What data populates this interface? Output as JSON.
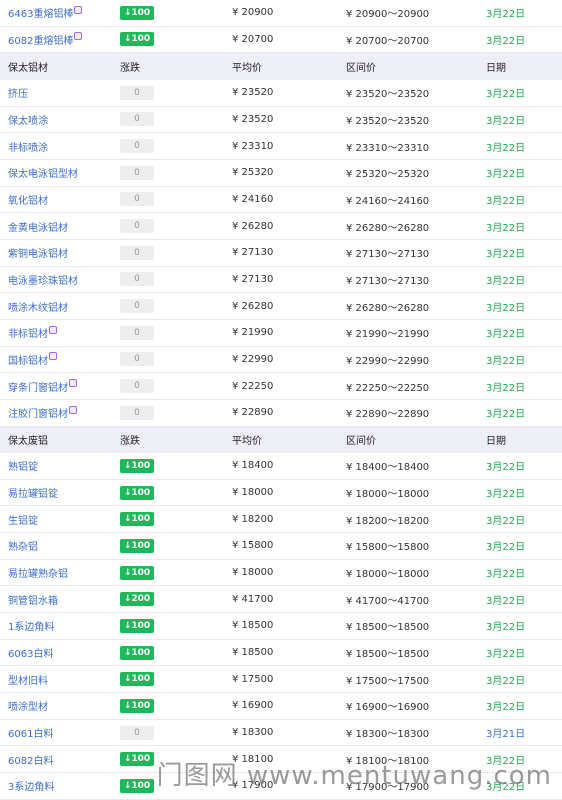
{
  "header": {
    "name": "",
    "change": "涨跌",
    "avg": "平均价",
    "range": "区间价",
    "date": "日期"
  },
  "rows": [
    {
      "type": "item",
      "name": "6463重熔铝棒",
      "mark": true,
      "change": "↓100",
      "dir": "up",
      "avg": "¥  20900",
      "range": "¥  20900～20900",
      "date": "3月22日"
    },
    {
      "type": "item",
      "name": "6082重熔铝棒",
      "mark": true,
      "change": "↓100",
      "dir": "up",
      "avg": "¥  20700",
      "range": "¥  20700～20700",
      "date": "3月22日"
    },
    {
      "type": "header",
      "name": "保太铝材"
    },
    {
      "type": "item",
      "name": "挤压",
      "mark": false,
      "change": "0",
      "dir": "flat",
      "avg": "¥  23520",
      "range": "¥  23520～23520",
      "date": "3月22日"
    },
    {
      "type": "item",
      "name": "保太喷涂",
      "mark": false,
      "change": "0",
      "dir": "flat",
      "avg": "¥  23520",
      "range": "¥  23520～23520",
      "date": "3月22日"
    },
    {
      "type": "item",
      "name": "非标喷涂",
      "mark": false,
      "change": "0",
      "dir": "flat",
      "avg": "¥  23310",
      "range": "¥  23310～23310",
      "date": "3月22日"
    },
    {
      "type": "item",
      "name": "保太电泳铝型材",
      "mark": false,
      "change": "0",
      "dir": "flat",
      "avg": "¥  25320",
      "range": "¥  25320～25320",
      "date": "3月22日"
    },
    {
      "type": "item",
      "name": "氧化铝材",
      "mark": false,
      "change": "0",
      "dir": "flat",
      "avg": "¥  24160",
      "range": "¥  24160～24160",
      "date": "3月22日"
    },
    {
      "type": "item",
      "name": "金黄电泳铝材",
      "mark": false,
      "change": "0",
      "dir": "flat",
      "avg": "¥  26280",
      "range": "¥  26280～26280",
      "date": "3月22日"
    },
    {
      "type": "item",
      "name": "紫铜电泳铝材",
      "mark": false,
      "change": "0",
      "dir": "flat",
      "avg": "¥  27130",
      "range": "¥  27130～27130",
      "date": "3月22日"
    },
    {
      "type": "item",
      "name": "电泳墨珍珠铝材",
      "mark": false,
      "change": "0",
      "dir": "flat",
      "avg": "¥  27130",
      "range": "¥  27130～27130",
      "date": "3月22日"
    },
    {
      "type": "item",
      "name": "喷涂木纹铝材",
      "mark": false,
      "change": "0",
      "dir": "flat",
      "avg": "¥  26280",
      "range": "¥  26280～26280",
      "date": "3月22日"
    },
    {
      "type": "item",
      "name": "非标铝材",
      "mark": true,
      "change": "0",
      "dir": "flat",
      "avg": "¥  21990",
      "range": "¥  21990～21990",
      "date": "3月22日"
    },
    {
      "type": "item",
      "name": "国标铝材",
      "mark": true,
      "change": "0",
      "dir": "flat",
      "avg": "¥  22990",
      "range": "¥  22990～22990",
      "date": "3月22日"
    },
    {
      "type": "item",
      "name": "穿条门窗铝材",
      "mark": true,
      "change": "0",
      "dir": "flat",
      "avg": "¥  22250",
      "range": "¥  22250～22250",
      "date": "3月22日"
    },
    {
      "type": "item",
      "name": "注胶门窗铝材",
      "mark": true,
      "change": "0",
      "dir": "flat",
      "avg": "¥  22890",
      "range": "¥  22890～22890",
      "date": "3月22日"
    },
    {
      "type": "header",
      "name": "保太废铝"
    },
    {
      "type": "item",
      "name": "熟铝锭",
      "mark": false,
      "change": "↓100",
      "dir": "up",
      "avg": "¥  18400",
      "range": "¥  18400～18400",
      "date": "3月22日"
    },
    {
      "type": "item",
      "name": "易拉罐铝锭",
      "mark": false,
      "change": "↓100",
      "dir": "up",
      "avg": "¥  18000",
      "range": "¥  18000～18000",
      "date": "3月22日"
    },
    {
      "type": "item",
      "name": "生铝锭",
      "mark": false,
      "change": "↓100",
      "dir": "up",
      "avg": "¥  18200",
      "range": "¥  18200～18200",
      "date": "3月22日"
    },
    {
      "type": "item",
      "name": "熟杂铝",
      "mark": false,
      "change": "↓100",
      "dir": "up",
      "avg": "¥  15800",
      "range": "¥  15800～15800",
      "date": "3月22日"
    },
    {
      "type": "item",
      "name": "易拉罐熟杂铝",
      "mark": false,
      "change": "↓100",
      "dir": "up",
      "avg": "¥  18000",
      "range": "¥  18000～18000",
      "date": "3月22日"
    },
    {
      "type": "item",
      "name": "铜管铝水箱",
      "mark": false,
      "change": "↓200",
      "dir": "up",
      "avg": "¥  41700",
      "range": "¥  41700～41700",
      "date": "3月22日"
    },
    {
      "type": "item",
      "name": "1系边角料",
      "mark": false,
      "change": "↓100",
      "dir": "up",
      "avg": "¥  18500",
      "range": "¥  18500～18500",
      "date": "3月22日"
    },
    {
      "type": "item",
      "name": "6063白料",
      "mark": false,
      "change": "↓100",
      "dir": "up",
      "avg": "¥  18500",
      "range": "¥  18500～18500",
      "date": "3月22日"
    },
    {
      "type": "item",
      "name": "型材旧料",
      "mark": false,
      "change": "↓100",
      "dir": "up",
      "avg": "¥  17500",
      "range": "¥  17500～17500",
      "date": "3月22日"
    },
    {
      "type": "item",
      "name": "喷涂型材",
      "mark": false,
      "change": "↓100",
      "dir": "up",
      "avg": "¥  16900",
      "range": "¥  16900～16900",
      "date": "3月22日"
    },
    {
      "type": "item",
      "name": "6061白料",
      "mark": false,
      "change": "0",
      "dir": "flat",
      "avg": "¥  18300",
      "range": "¥  18300～18300",
      "date": "3月21日",
      "date_old": true
    },
    {
      "type": "item",
      "name": "6082白料",
      "mark": false,
      "change": "↓100",
      "dir": "up",
      "avg": "¥  18100",
      "range": "¥  18100～18100",
      "date": "3月22日"
    },
    {
      "type": "item",
      "name": "3系边角料",
      "mark": false,
      "change": "↓100",
      "dir": "up",
      "avg": "¥  17900",
      "range": "¥  17900～17900",
      "date": "3月22日"
    }
  ],
  "watermark": "门图网 www.mentuwang.com",
  "colors": {
    "up_badge": "#1fb85a",
    "date": "#1fa84e",
    "link": "#3c6fd1",
    "header_bg": "#eeeef7"
  }
}
